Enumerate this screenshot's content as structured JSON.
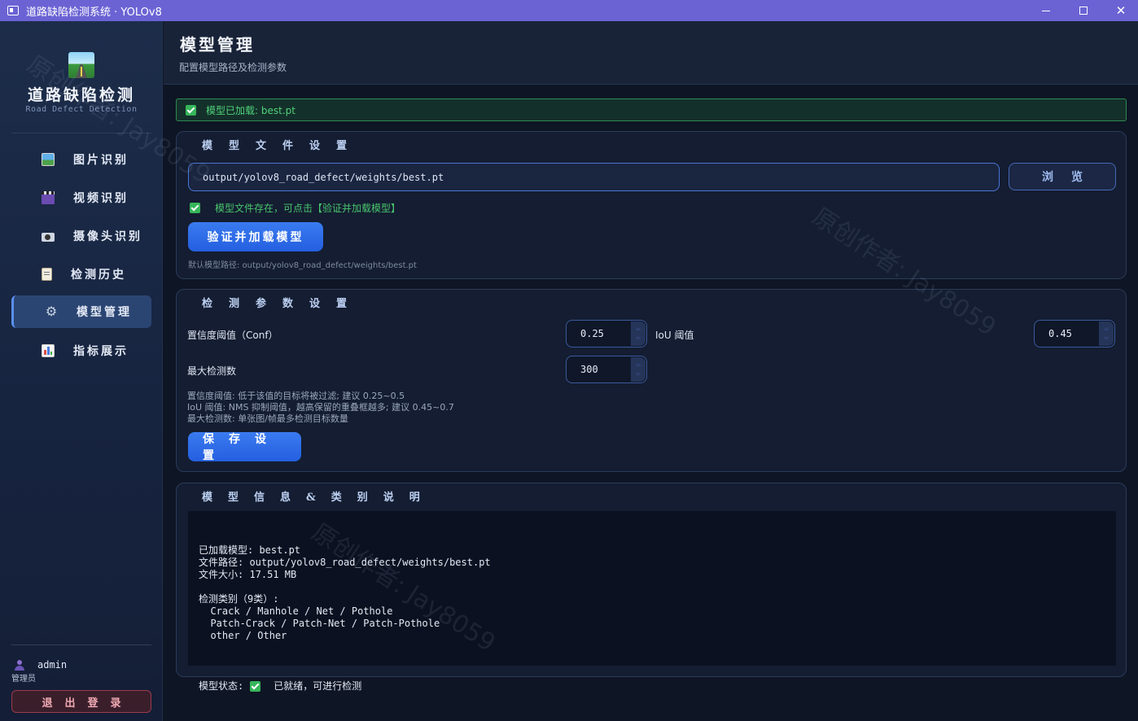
{
  "window": {
    "title": "道路缺陷检测系统 · YOLOv8",
    "minimize": "-",
    "maximize": "□",
    "close": "✕"
  },
  "sidebar": {
    "brand_title": "道路缺陷检测",
    "brand_subtitle": "Road Defect Detection",
    "items": [
      {
        "label": "图片识别",
        "icon": "image-icon"
      },
      {
        "label": "视频识别",
        "icon": "clapper-icon"
      },
      {
        "label": "摄像头识别",
        "icon": "camera-icon"
      },
      {
        "label": "检测历史",
        "icon": "clipboard-icon"
      },
      {
        "label": "模型管理",
        "icon": "gear-icon",
        "active": true
      },
      {
        "label": "指标展示",
        "icon": "chart-icon"
      }
    ],
    "user": {
      "name": "admin",
      "role": "管理员"
    },
    "logout_label": "退出登录"
  },
  "header": {
    "title": "模型管理",
    "subtitle": "配置模型路径及检测参数"
  },
  "status_banner": "模型已加载: best.pt",
  "model_file": {
    "title": "模型文件设置",
    "path_value": "output/yolov8_road_defect/weights/best.pt",
    "browse_label": "浏览",
    "exists_text": "模型文件存在，可点击【验证并加载模型】",
    "load_button": "验证并加载模型",
    "default_hint": "默认模型路径: output/yolov8_road_defect/weights/best.pt"
  },
  "params": {
    "title": "检测参数设置",
    "conf_label": "置信度阈值（Conf）",
    "conf_value": "0.25",
    "iou_label": "IoU 阈值",
    "iou_value": "0.45",
    "max_label": "最大检测数",
    "max_value": "300",
    "hint_1": "置信度阈值: 低于该值的目标将被过滤; 建议 0.25~0.5",
    "hint_2": "IoU 阈值: NMS 抑制阈值，越高保留的重叠框越多; 建议 0.45~0.7",
    "hint_3": "最大检测数: 单张图/帧最多检测目标数量",
    "save_button": "保存设置"
  },
  "model_info": {
    "title": "模型信息&类别说明",
    "content": "已加载模型: best.pt\n文件路径: output/yolov8_road_defect/weights/best.pt\n文件大小: 17.51 MB\n\n检测类别（9类）:\n  Crack / Manhole / Net / Pothole\n  Patch-Crack / Patch-Net / Patch-Pothole\n  other / Other",
    "status_label": "模型状态:",
    "status_value": "已就绪，可进行检测"
  },
  "watermark": "原创作者: Jay8059",
  "colors": {
    "accent": "#245fe0",
    "success": "#36b65a",
    "title_bar": "#6b63d4",
    "danger": "#9b3a4a"
  }
}
